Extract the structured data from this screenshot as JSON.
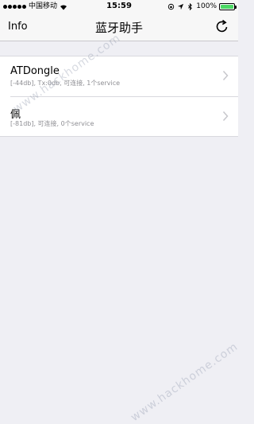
{
  "status_bar": {
    "carrier": "中国移动",
    "time": "15:59",
    "battery": "100%",
    "battery_level": 1.0
  },
  "nav": {
    "left_label": "Info",
    "title": "蓝牙助手",
    "right_icon": "refresh-icon"
  },
  "devices": [
    {
      "name": "ATDongle",
      "detail": "[-44db], Tx:0db, 可连接, 1个service"
    },
    {
      "name": "佩",
      "detail": "[-81db], 可连接, 0个service"
    }
  ],
  "watermark": {
    "text1": "www.hackhome.com",
    "text2": "www.hackhome.com"
  },
  "colors": {
    "background": "#efeff4",
    "bar": "#f7f7f7",
    "battery_fill": "#4cd964",
    "detail_text": "#8e8e93",
    "chevron": "#c7c7cc"
  }
}
